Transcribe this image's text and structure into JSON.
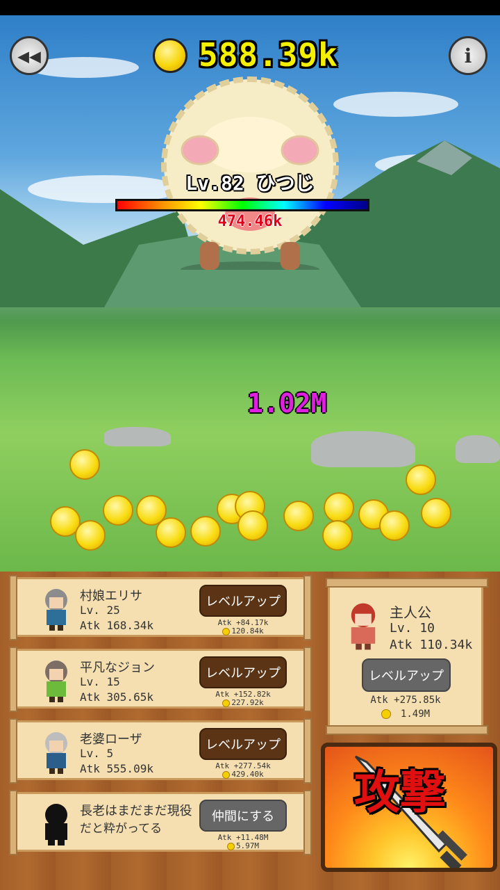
{
  "hud": {
    "back_icon": "rewind-icon",
    "info_icon": "info-icon",
    "gold_amount": "588.39k"
  },
  "enemy": {
    "name": "Lv.82 ひつじ",
    "hp_text": "474.46k"
  },
  "damage_popup": "1.02M",
  "party": [
    {
      "name": "村娘エリサ",
      "level": "Lv. 25",
      "atk": "Atk 168.34k",
      "button": "レベルアップ",
      "atk_gain": "Atk +84.17k",
      "cost": "120.84k"
    },
    {
      "name": "平凡なジョン",
      "level": "Lv. 15",
      "atk": "Atk 305.65k",
      "button": "レベルアップ",
      "atk_gain": "Atk +152.82k",
      "cost": "227.92k"
    },
    {
      "name": "老婆ローザ",
      "level": "Lv. 5",
      "atk": "Atk 555.09k",
      "button": "レベルアップ",
      "atk_gain": "Atk +277.54k",
      "cost": "429.40k"
    },
    {
      "name": "長老はまだまだ現役",
      "name2": "だと粋がってる",
      "button": "仲間にする",
      "atk_gain": "Atk +11.48M",
      "cost": "5.97M"
    }
  ],
  "hero": {
    "name": "主人公",
    "level": "Lv. 10",
    "atk": "Atk 110.34k",
    "button": "レベルアップ",
    "atk_gain": "Atk +275.85k",
    "cost": "1.49M"
  },
  "attack_button": {
    "label": "攻撃"
  },
  "colors": {
    "gold_text": "#f4f000",
    "damage_text": "#e020e0",
    "hp_text": "#e00018",
    "attack_label": "#e01010"
  }
}
